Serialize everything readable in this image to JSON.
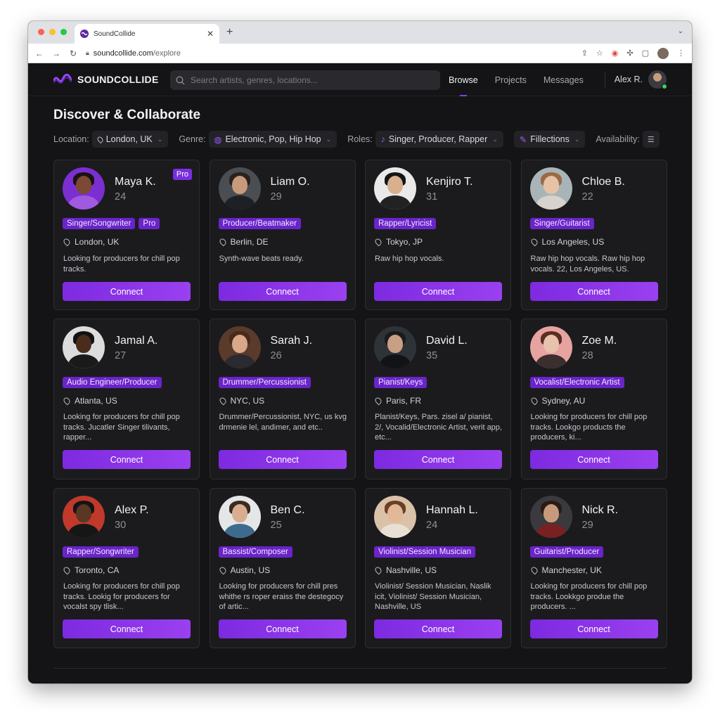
{
  "browser": {
    "tab_title": "SoundCollide",
    "url_host": "soundcollide.com",
    "url_path": "/explore"
  },
  "app": {
    "brand": "SOUNDCOLLIDE",
    "search_placeholder": "Search artists, genres, locations...",
    "nav": [
      "Browse",
      "Projects",
      "Messages"
    ],
    "active_nav": "Browse",
    "user_name": "Alex R."
  },
  "page": {
    "title": "Discover & Collaborate",
    "filters": {
      "location_label": "Location:",
      "location_value": "London, UK",
      "genre_label": "Genre:",
      "genre_value": "Electronic, Pop, Hip Hop",
      "roles_label": "Roles:",
      "roles_value": "Singer, Producer, Rapper",
      "collections_value": "Fillections",
      "availability_label": "Availability:"
    }
  },
  "profiles": [
    {
      "name": "Maya K.",
      "age": "24",
      "pro": "Pro",
      "tags": [
        "Singer/Songwriter",
        "Pro"
      ],
      "location": "London, UK",
      "desc": "Looking for producers for chill pop tracks.",
      "connect": "Connect",
      "avatar": {
        "bg": "#7b2fd0",
        "skin": "#7a4a35",
        "hair": "#1a1210",
        "shirt": "#a05ae0"
      }
    },
    {
      "name": "Liam O.",
      "age": "29",
      "tags": [
        "Producer/Beatmaker"
      ],
      "location": "Berlin, DE",
      "desc": "Synth-wave beats ready.",
      "connect": "Connect",
      "avatar": {
        "bg": "#4a4e52",
        "skin": "#c79a7c",
        "hair": "#2a221e",
        "shirt": "#1d2024"
      }
    },
    {
      "name": "Kenjiro T.",
      "age": "31",
      "tags": [
        "Rapper/Lyricist"
      ],
      "location": "Tokyo, JP",
      "desc": "Raw hip hop vocals.",
      "connect": "Connect",
      "avatar": {
        "bg": "#e9e9ea",
        "skin": "#d9b08e",
        "hair": "#151515",
        "shirt": "#222222"
      }
    },
    {
      "name": "Chloe B.",
      "age": "22",
      "tags": [
        "Singer/Guitarist"
      ],
      "location": "Los Angeles, US",
      "desc": "Raw hip hop vocals. Raw hip hop vocals. 22, Los Angeles, US.",
      "connect": "Connect",
      "avatar": {
        "bg": "#a9b4b8",
        "skin": "#e6c2a6",
        "hair": "#9a6a44",
        "shirt": "#d8d2cc"
      }
    },
    {
      "name": "Jamal A.",
      "age": "27",
      "tags": [
        "Audio Engineer/Producer"
      ],
      "location": "Atlanta, US",
      "desc": "Looking for producers for chill pop tracks. Jucatler Singer tilivants, rapper...",
      "connect": "Connect",
      "avatar": {
        "bg": "#dcdcdc",
        "skin": "#4a2c1c",
        "hair": "#111111",
        "shirt": "#1a1a1a"
      }
    },
    {
      "name": "Sarah J.",
      "age": "26",
      "tags": [
        "Drummer/Percussionist"
      ],
      "location": "NYC, US",
      "desc": "Drummer/Percussionist, NYC, us kvg drmenie lel, andimer, and etc..",
      "connect": "Connect",
      "avatar": {
        "bg": "#5a3a2a",
        "skin": "#d8a889",
        "hair": "#4a2a1a",
        "shirt": "#2a2a30"
      }
    },
    {
      "name": "David L.",
      "age": "35",
      "tags": [
        "Pianist/Keys"
      ],
      "location": "Paris, FR",
      "desc": "Planist/Keys, Pars. zisel a/ pianist, 2/, Vocalid/Electronic Artist, verit app, etc...",
      "connect": "Connect",
      "avatar": {
        "bg": "#2e3338",
        "skin": "#c99f84",
        "hair": "#1b1b1b",
        "shirt": "#111316"
      }
    },
    {
      "name": "Zoe M.",
      "age": "28",
      "tags": [
        "Vocalist/Electronic Artist"
      ],
      "location": "Sydney, AU",
      "desc": "Looking for producers for chill pop tracks. Lookgo products the producers, ki...",
      "connect": "Connect",
      "avatar": {
        "bg": "#e6a3a0",
        "skin": "#e9c2ae",
        "hair": "#5a2e22",
        "shirt": "#3a2e2e"
      }
    },
    {
      "name": "Alex P.",
      "age": "30",
      "tags": [
        "Rapper/Songwriter"
      ],
      "location": "Toronto, CA",
      "desc": "Looking for producers for chill pop tracks. Lookig for producers for vocalst spy tlisk...",
      "connect": "Connect",
      "avatar": {
        "bg": "#c0392b",
        "skin": "#5a3624",
        "hair": "#141414",
        "shirt": "#161616"
      }
    },
    {
      "name": "Ben C.",
      "age": "25",
      "tags": [
        "Bassist/Composer"
      ],
      "location": "Austin, US",
      "desc": "Looking for producers for chill pres whithe rs roper eraiss the destegocy of artic...",
      "connect": "Connect",
      "avatar": {
        "bg": "#e4e6e8",
        "skin": "#d9ae90",
        "hair": "#3a2a20",
        "shirt": "#3d6b8e"
      }
    },
    {
      "name": "Hannah L.",
      "age": "24",
      "tags": [
        "Violinist/Session Musician"
      ],
      "location": "Nashville, US",
      "desc": "Violinist/ Session Musician, Naslik icit, Violinist/ Session Musician, Nashville, US",
      "connect": "Connect",
      "avatar": {
        "bg": "#d9c2a8",
        "skin": "#e3b898",
        "hair": "#6b4026",
        "shirt": "#e8e0d4"
      }
    },
    {
      "name": "Nick R.",
      "age": "29",
      "tags": [
        "Guitarist/Producer"
      ],
      "location": "Manchester, UK",
      "desc": "Looking for producers for chill pop tracks. Lookkgo produe the producers. ...",
      "connect": "Connect",
      "avatar": {
        "bg": "#3a3a3e",
        "skin": "#c89a7c",
        "hair": "#2a1c14",
        "shirt": "#7a2020"
      }
    }
  ]
}
